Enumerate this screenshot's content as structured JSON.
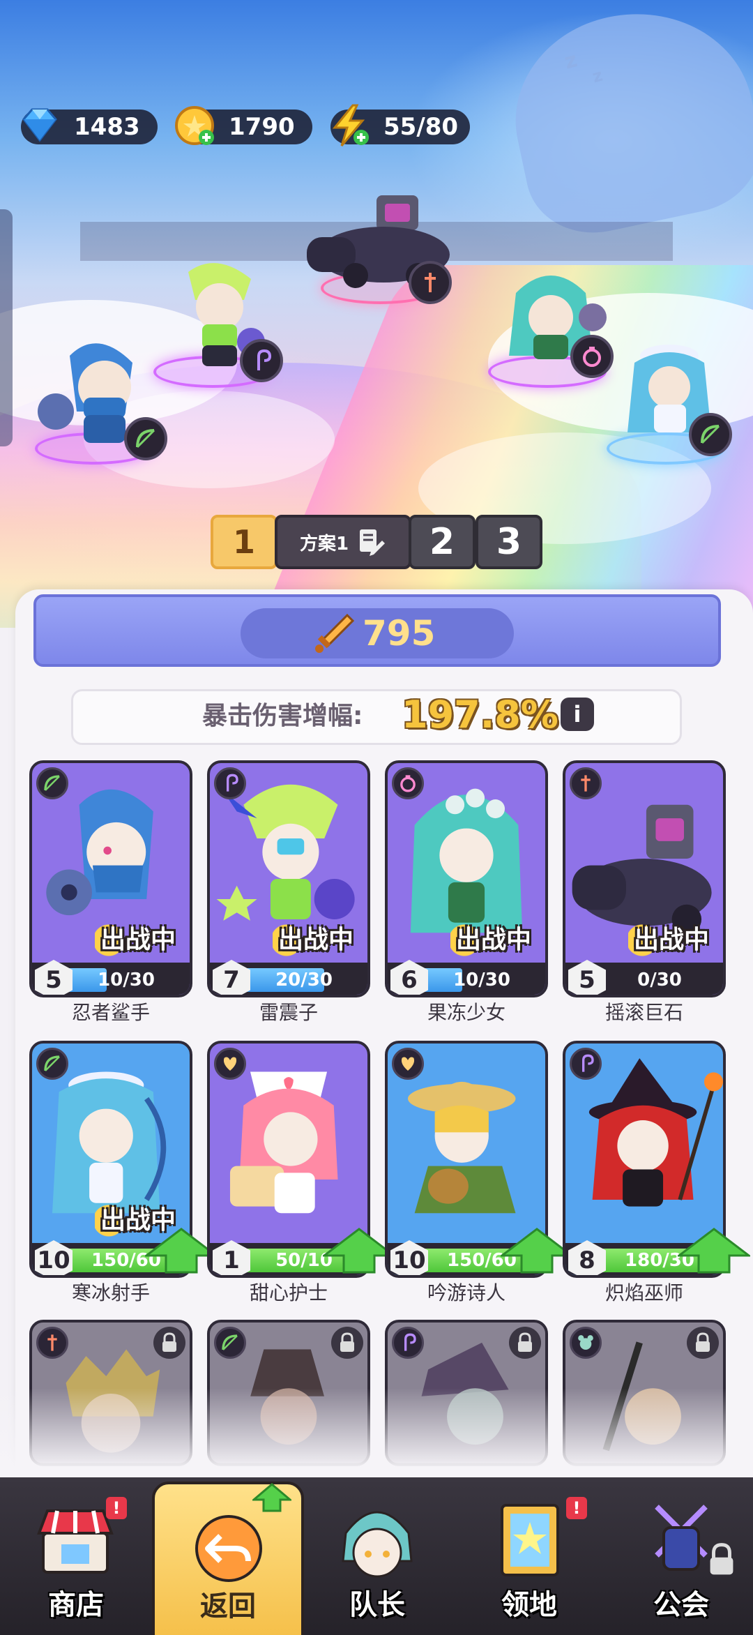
{
  "currencies": {
    "gems": "1483",
    "coins": "1790",
    "energy": "55/80"
  },
  "plans": {
    "selected": "1",
    "name": "方案1",
    "others": [
      "2",
      "3"
    ]
  },
  "power": "795",
  "crit": {
    "label": "暴击伤害增幅:",
    "value": "197.8%",
    "info": "i"
  },
  "deploy_label": "出战中",
  "heroes": [
    {
      "name": "忍者鲨手",
      "level": "5",
      "exp": "10/30",
      "progress": 0.33,
      "deployed": true,
      "upgrade": false,
      "class": "archer"
    },
    {
      "name": "雷震子",
      "level": "7",
      "exp": "20/30",
      "progress": 0.67,
      "deployed": true,
      "upgrade": false,
      "class": "mage"
    },
    {
      "name": "果冻少女",
      "level": "6",
      "exp": "10/30",
      "progress": 0.33,
      "deployed": true,
      "upgrade": false,
      "class": "support"
    },
    {
      "name": "摇滚巨石",
      "level": "5",
      "exp": "0/30",
      "progress": 0.0,
      "deployed": true,
      "upgrade": false,
      "class": "warrior"
    },
    {
      "name": "寒冰射手",
      "level": "10",
      "exp": "150/60",
      "progress": 1.0,
      "deployed": true,
      "upgrade": true,
      "class": "archer"
    },
    {
      "name": "甜心护士",
      "level": "1",
      "exp": "50/10",
      "progress": 1.0,
      "deployed": false,
      "upgrade": true,
      "class": "healer"
    },
    {
      "name": "吟游诗人",
      "level": "10",
      "exp": "150/60",
      "progress": 1.0,
      "deployed": false,
      "upgrade": true,
      "class": "healer"
    },
    {
      "name": "炽焰巫师",
      "level": "8",
      "exp": "180/30",
      "progress": 1.0,
      "deployed": false,
      "upgrade": true,
      "class": "mage"
    }
  ],
  "locked_heroes": [
    {
      "class": "warrior"
    },
    {
      "class": "archer"
    },
    {
      "class": "mage"
    },
    {
      "class": "beast"
    }
  ],
  "nav": {
    "shop": "商店",
    "back": "返回",
    "captain": "队长",
    "territory": "领地",
    "guild": "公会",
    "alert": "!"
  },
  "colors": {
    "accent_gold": "#f7c869",
    "card_purple": "#8f73e8",
    "card_blue": "#56a5f0",
    "exp_blue": "#3b97ea",
    "exp_green": "#4fc63a",
    "alert_red": "#e8384a"
  }
}
